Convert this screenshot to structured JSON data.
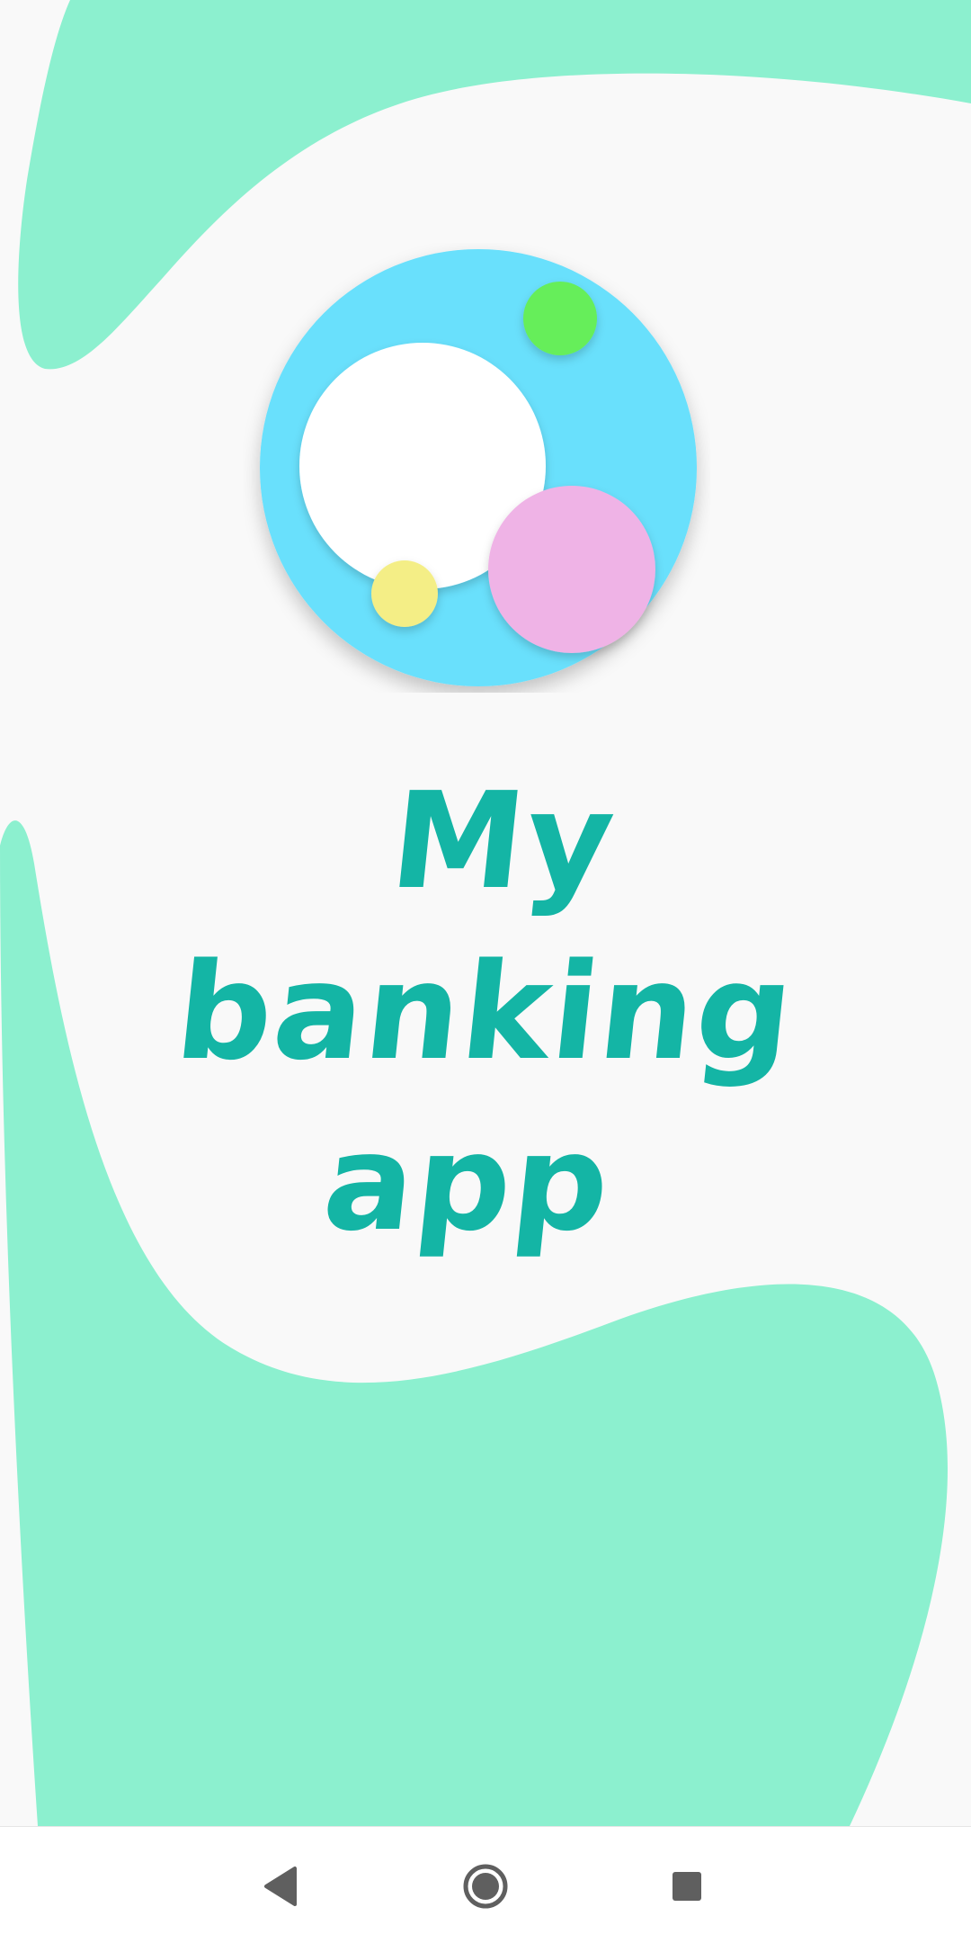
{
  "splash": {
    "title_line1": "My",
    "title_line2": "banking",
    "title_line3": "app"
  },
  "logo": {
    "icon": "bubbles-logo-icon",
    "colors": {
      "outer": "#69e0fc",
      "white": "#ffffff",
      "green": "#66ee5a",
      "pink": "#efb3e6",
      "yellow": "#f4ee86"
    }
  },
  "theme": {
    "background": "#f9f9f9",
    "blob": "#8cf0cf",
    "title_color": "#14b5a5"
  },
  "nav_bar": {
    "back_icon": "back-triangle-icon",
    "home_icon": "home-circle-icon",
    "recents_icon": "recents-square-icon"
  }
}
